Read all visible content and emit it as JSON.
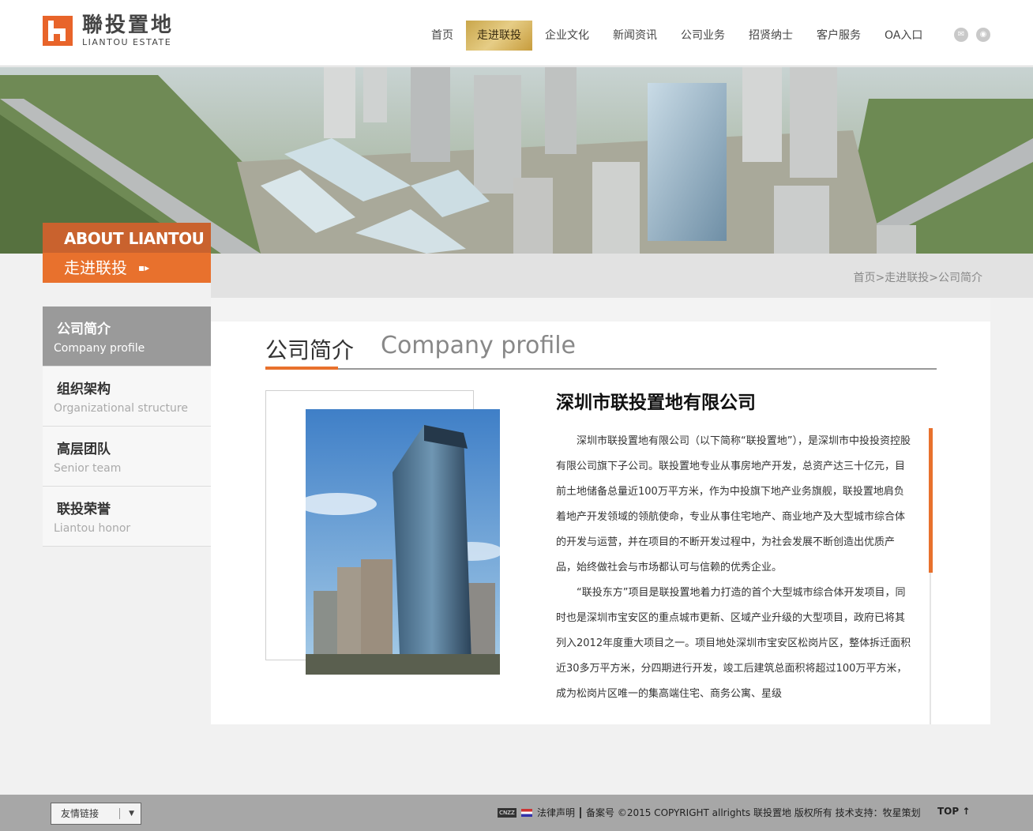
{
  "logo": {
    "cn": "聯投置地",
    "en": "LIANTOU ESTATE"
  },
  "nav": {
    "items": [
      {
        "label": "首页"
      },
      {
        "label": "走进联投",
        "active": true
      },
      {
        "label": "企业文化"
      },
      {
        "label": "新闻资讯"
      },
      {
        "label": "公司业务"
      },
      {
        "label": "招贤纳士"
      },
      {
        "label": "客户服务"
      },
      {
        "label": "OA入口"
      }
    ],
    "social": [
      "wechat-icon",
      "weibo-icon"
    ]
  },
  "about": {
    "en": "ABOUT LIANTOU",
    "cn": "走进联投"
  },
  "breadcrumb": "首页>走进联投>公司简介",
  "sidebar": {
    "items": [
      {
        "cn": "公司简介",
        "en": "Company profile",
        "active": true
      },
      {
        "cn": "组织架构",
        "en": "Organizational structure"
      },
      {
        "cn": "高层团队",
        "en": "Senior team"
      },
      {
        "cn": "联投荣誉",
        "en": "Liantou honor"
      }
    ]
  },
  "main": {
    "title_cn": "公司简介",
    "title_en": "Company profile",
    "company_name": "深圳市联投置地有限公司",
    "paragraphs": [
      "深圳市联投置地有限公司（以下简称“联投置地”），是深圳市中投投资控股有限公司旗下子公司。联投置地专业从事房地产开发，总资产达三十亿元，目前土地储备总量近100万平方米，作为中投旗下地产业务旗舰，联投置地肩负着地产开发领域的领航使命，专业从事住宅地产、商业地产及大型城市综合体的开发与运营，并在项目的不断开发过程中，为社会发展不断创造出优质产品，始终做社会与市场都认可与信赖的优秀企业。",
      "“联投东方”项目是联投置地着力打造的首个大型城市综合体开发项目，同时也是深圳市宝安区的重点城市更新、区域产业升级的大型项目，政府已将其列入2012年度重大项目之一。项目地处深圳市宝安区松岗片区，整体拆迁面积近30多万平方米，分四期进行开发，竣工后建筑总面积将超过100万平方米，成为松岗片区唯一的集高端住宅、商务公寓、星级"
    ]
  },
  "footer": {
    "links_label": "友情链接",
    "badge": "CNZZ",
    "legal": "法律声明",
    "copyright": "备案号 ©2015 COPYRIGHT allrights 联投置地 版权所有 技术支持：牧星策划",
    "top": "TOP ↑"
  },
  "colors": {
    "accent": "#e8712d",
    "nav_active": "#d4b05a",
    "sidebar_active": "#9a9a9a"
  }
}
